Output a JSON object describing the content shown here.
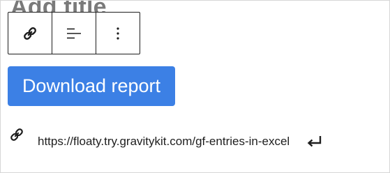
{
  "block": {
    "title_placeholder": "Add title"
  },
  "toolbar": {
    "buttons": [
      {
        "icon": "link-icon"
      },
      {
        "icon": "align-left-icon"
      },
      {
        "icon": "more-options-icon"
      }
    ]
  },
  "button_block": {
    "label": "Download report",
    "color": "#3c80e5"
  },
  "link_editor": {
    "url_value": "https://floaty.try.gravitykit.com/gf-entries-in-excel/",
    "submit_icon": "enter-icon"
  }
}
